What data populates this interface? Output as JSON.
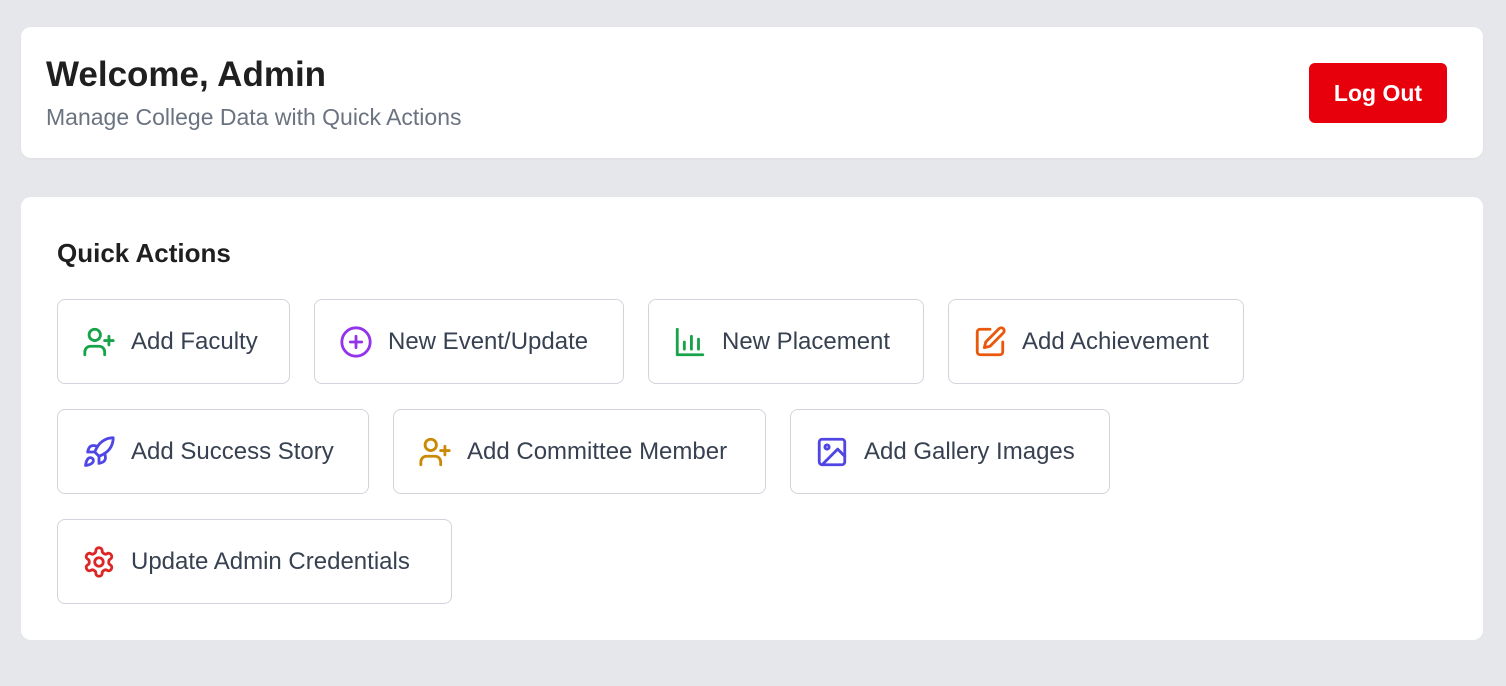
{
  "header": {
    "title": "Welcome, Admin",
    "subtitle": "Manage College Data with Quick Actions",
    "logout_label": "Log Out"
  },
  "quick_actions": {
    "title": "Quick Actions",
    "items": [
      {
        "label": "Add Faculty",
        "icon": "user-plus-icon",
        "color": "#16a34a"
      },
      {
        "label": "New Event/Update",
        "icon": "plus-circle-icon",
        "color": "#9333ea"
      },
      {
        "label": "New Placement",
        "icon": "bar-chart-icon",
        "color": "#16a34a"
      },
      {
        "label": "Add Achievement",
        "icon": "edit-icon",
        "color": "#ea580c"
      },
      {
        "label": "Add Success Story",
        "icon": "rocket-icon",
        "color": "#4f46e5"
      },
      {
        "label": "Add Committee Member",
        "icon": "user-plus-icon",
        "color": "#ca8a04"
      },
      {
        "label": "Add Gallery Images",
        "icon": "image-icon",
        "color": "#4f46e5"
      },
      {
        "label": "Update Admin Credentials",
        "icon": "settings-icon",
        "color": "#dc2626"
      }
    ]
  },
  "colors": {
    "background": "#e5e7eb",
    "card": "#ffffff",
    "logout": "#e7000b"
  }
}
